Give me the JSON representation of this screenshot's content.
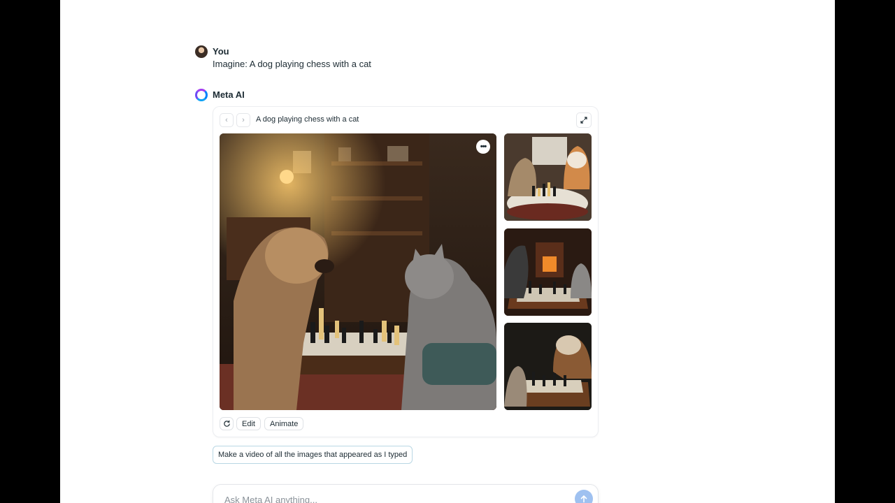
{
  "user": {
    "name": "You",
    "message": "Imagine: A dog playing chess with a cat",
    "avatar_icon": "user-avatar"
  },
  "assistant": {
    "name": "Meta AI",
    "logo_icon": "meta-ai-ring-icon",
    "card": {
      "title": "A dog playing chess with a cat",
      "prev_icon": "chevron-left-icon",
      "next_icon": "chevron-right-icon",
      "expand_icon": "expand-icon",
      "more_label": "•••",
      "main_image_alt": "A dog playing chess with a cat",
      "thumbnails": [
        {
          "alt": "Cat and dog at round chess board"
        },
        {
          "alt": "Dog and cat by fireplace with chess board"
        },
        {
          "alt": "Cat and dog facing each other over chess board"
        }
      ],
      "actions": {
        "regenerate_icon": "refresh-icon",
        "edit_label": "Edit",
        "animate_label": "Animate"
      }
    }
  },
  "suggestion": {
    "label": "Make a video of all the images that appeared as I typed"
  },
  "composer": {
    "placeholder": "Ask Meta AI anything...",
    "value": "",
    "send_icon": "arrow-up-icon"
  },
  "colors": {
    "accent": "#0866ff",
    "send_button": "#9fc1f0",
    "text": "#1c2b33"
  }
}
